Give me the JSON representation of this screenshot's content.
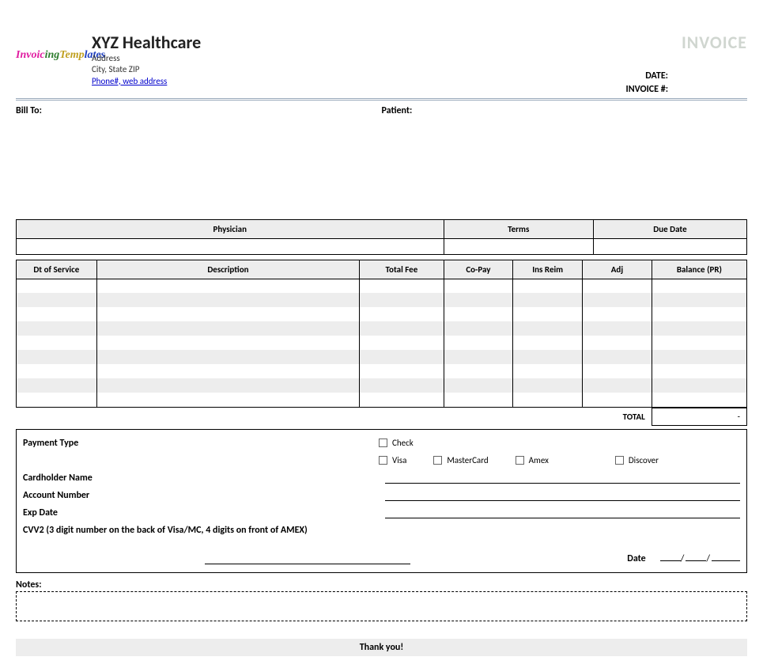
{
  "header": {
    "logo_text_parts": [
      "Invoic",
      "ing",
      "Temp",
      "lates"
    ],
    "company_name": "XYZ Healthcare",
    "address_line1": "Address",
    "address_line2": "City, State ZIP",
    "contact_link": "Phone#, web address",
    "invoice_title": "INVOICE",
    "date_label": "DATE:",
    "date_value": "",
    "invoice_num_label": "INVOICE #:",
    "invoice_num_value": ""
  },
  "parties": {
    "bill_to_label": "Bill To:",
    "bill_to_value": "",
    "patient_label": "Patient:",
    "patient_value": ""
  },
  "meta_cols": {
    "physician": "Physician",
    "terms": "Terms",
    "due_date": "Due Date"
  },
  "meta_vals": {
    "physician": "",
    "terms": "",
    "due_date": ""
  },
  "line_cols": {
    "date": "Dt of Service",
    "desc": "Description",
    "fee": "Total Fee",
    "copay": "Co-Pay",
    "ins": "Ins Reim",
    "adj": "Adj",
    "bal": "Balance (PR)"
  },
  "line_items": [
    {
      "date": "",
      "desc": "",
      "fee": "",
      "copay": "",
      "ins": "",
      "adj": "",
      "bal": ""
    },
    {
      "date": "",
      "desc": "",
      "fee": "",
      "copay": "",
      "ins": "",
      "adj": "",
      "bal": ""
    },
    {
      "date": "",
      "desc": "",
      "fee": "",
      "copay": "",
      "ins": "",
      "adj": "",
      "bal": ""
    },
    {
      "date": "",
      "desc": "",
      "fee": "",
      "copay": "",
      "ins": "",
      "adj": "",
      "bal": ""
    },
    {
      "date": "",
      "desc": "",
      "fee": "",
      "copay": "",
      "ins": "",
      "adj": "",
      "bal": ""
    },
    {
      "date": "",
      "desc": "",
      "fee": "",
      "copay": "",
      "ins": "",
      "adj": "",
      "bal": ""
    },
    {
      "date": "",
      "desc": "",
      "fee": "",
      "copay": "",
      "ins": "",
      "adj": "",
      "bal": ""
    },
    {
      "date": "",
      "desc": "",
      "fee": "",
      "copay": "",
      "ins": "",
      "adj": "",
      "bal": ""
    },
    {
      "date": "",
      "desc": "",
      "fee": "",
      "copay": "",
      "ins": "",
      "adj": "",
      "bal": ""
    }
  ],
  "totals": {
    "label": "TOTAL",
    "value": "-"
  },
  "payment": {
    "type_label": "Payment Type",
    "options": {
      "check": "Check",
      "visa": "Visa",
      "mastercard": "MasterCard",
      "amex": "Amex",
      "discover": "Discover"
    },
    "cardholder_label": "Cardholder Name",
    "account_label": "Account Number",
    "exp_label": "Exp Date",
    "cvv_label": "CVV2 (3 digit number on the back of Visa/MC, 4 digits on front of AMEX)",
    "sign_date_label": "Date",
    "sign_date_value": "__/__/___"
  },
  "notes": {
    "label": "Notes:",
    "value": ""
  },
  "footer": {
    "thanks": "Thank you!"
  }
}
